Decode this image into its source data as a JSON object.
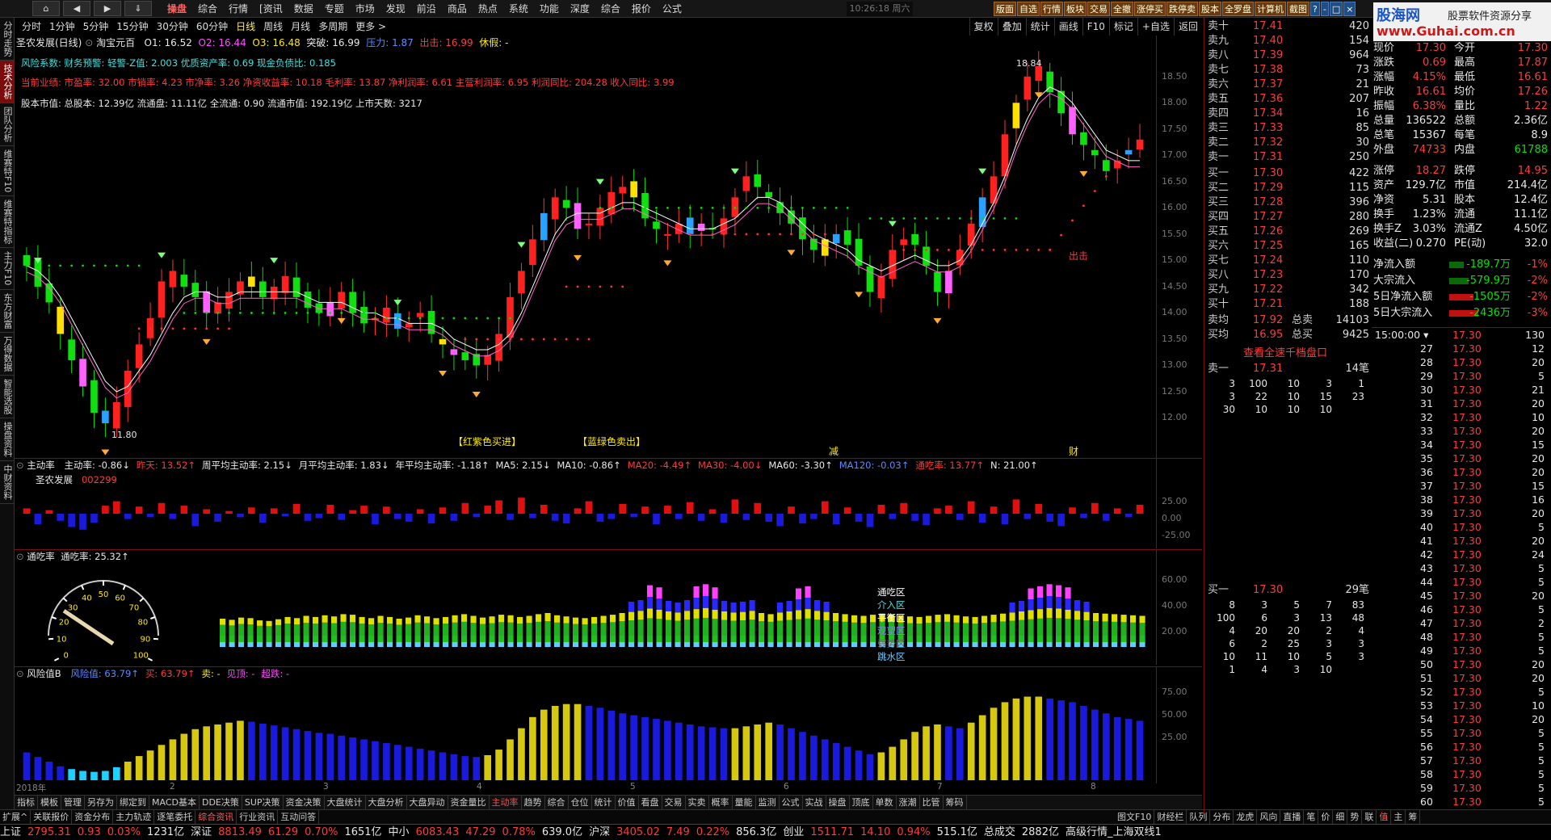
{
  "menubar": {
    "nav": [
      "⌂",
      "◀",
      "▶",
      "⇓"
    ],
    "menus": [
      "操盘",
      "综合",
      "行情",
      "[资讯",
      "数据",
      "专题",
      "市场",
      "发现",
      "前沿",
      "商品",
      "热点",
      "系统",
      "功能",
      "深度",
      "综合",
      "报价",
      "公式"
    ],
    "active_menu": "操盘",
    "clock": "10:26:18 周六",
    "tools": [
      "版面",
      "自选",
      "行情",
      "板块",
      "交易",
      "全撤",
      "涨停买",
      "跌停卖",
      "股本",
      "全罗盘",
      "计算机",
      "截图",
      "?",
      "-",
      "□",
      "×"
    ]
  },
  "logo": {
    "line1": "股海网",
    "line2": "股票软件资源分享",
    "line3": "www.Guhai.com.cn"
  },
  "left_tabs": [
    "分时走势",
    "技术分析",
    "团队分析",
    "维赛特F10",
    "维赛特指标",
    "主力F10",
    "东方财富",
    "万得数据",
    "智能选股",
    "操盘资料",
    "中财资料"
  ],
  "periods": [
    "分时",
    "1分钟",
    "5分钟",
    "15分钟",
    "30分钟",
    "60分钟",
    "日线",
    "周线",
    "月线",
    "多周期",
    "更多 >"
  ],
  "active_period": "日线",
  "right_tools": [
    "复权",
    "叠加",
    "统计",
    "画线",
    "F10",
    "标记",
    "+自选",
    "返回"
  ],
  "stock": {
    "name": "圣农发展(日线)",
    "sub": "淘宝元百",
    "o1": "O1: 16.52",
    "o2": "O2: 16.44",
    "o3": "O3: 16.48",
    "tupo": "突破: 16.99",
    "yali": "压力: 1.87",
    "chuhuo": "出击: 16.99",
    "xiu": "休假: -"
  },
  "info": [
    "风险系数: 财务预警: 轻警-Z值: 2.003 优质资产率: 0.69 现金负债比: 0.185",
    "当前业绩: 市盈率: 32.00 市销率: 4.23 市净率: 3.26 净资收益率: 10.18 毛利率: 13.87 净利润率: 6.61 主营利润率: 6.95 利润同比: 204.28 收入同比: 3.99",
    "股本市值: 总股本: 12.39亿 流通盘: 11.11亿 全流通: 0.90 流通市值: 192.19亿 上市天数: 3217"
  ],
  "signals": {
    "buy": "【红紫色买进】",
    "sell": "【蓝绿色卖出】",
    "jian": "减",
    "cai": "财",
    "chu": "出击",
    "high": "18.84",
    "low": "11.80"
  },
  "price_axis": [
    "18.50",
    "18.00",
    "17.50",
    "17.00",
    "16.50",
    "16.00",
    "15.50",
    "15.00",
    "14.50",
    "14.00",
    "13.50",
    "13.00",
    "12.50",
    "12.00"
  ],
  "price_axis_values": [
    18.5,
    18.0,
    17.5,
    17.0,
    16.5,
    16.0,
    15.5,
    15.0,
    14.5,
    14.0,
    13.5,
    13.0,
    12.5,
    12.0
  ],
  "chart_data": {
    "type": "candlestick",
    "closes": [
      14.9,
      14.5,
      14.2,
      13.6,
      13.1,
      12.6,
      12.1,
      11.9,
      12.3,
      12.9,
      13.4,
      13.9,
      14.6,
      14.8,
      14.5,
      14.3,
      14.0,
      14.2,
      14.4,
      14.6,
      14.5,
      14.3,
      14.5,
      14.7,
      14.3,
      14.1,
      14.0,
      14.2,
      14.4,
      14.0,
      13.8,
      13.9,
      14.1,
      13.7,
      13.8,
      14.0,
      13.6,
      13.4,
      13.2,
      13.1,
      13.0,
      13.2,
      13.6,
      14.3,
      14.8,
      15.4,
      15.9,
      16.2,
      16.0,
      15.6,
      15.7,
      16.0,
      16.3,
      16.4,
      16.2,
      15.8,
      15.6,
      15.5,
      15.7,
      15.5,
      15.7,
      15.6,
      15.8,
      16.2,
      16.6,
      16.4,
      16.2,
      15.9,
      15.7,
      15.4,
      15.2,
      15.4,
      15.5,
      15.3,
      14.9,
      14.4,
      14.7,
      15.2,
      15.4,
      15.3,
      14.9,
      14.4,
      14.8,
      15.2,
      15.7,
      16.2,
      16.6,
      17.4,
      18.0,
      18.5,
      18.7,
      18.2,
      17.8,
      17.4,
      17.2,
      17.0,
      16.7,
      16.9,
      17.1,
      17.3
    ],
    "ma": [
      14.9,
      14.8,
      14.6,
      14.3,
      13.9,
      13.5,
      13.1,
      12.7,
      12.5,
      12.6,
      12.9,
      13.2,
      13.6,
      14.0,
      14.3,
      14.4,
      14.4,
      14.3,
      14.3,
      14.4,
      14.4,
      14.4,
      14.4,
      14.4,
      14.4,
      14.3,
      14.2,
      14.2,
      14.2,
      14.1,
      14.0,
      14.0,
      13.9,
      13.9,
      13.8,
      13.8,
      13.8,
      13.7,
      13.5,
      13.4,
      13.3,
      13.3,
      13.4,
      13.6,
      14.0,
      14.5,
      15.0,
      15.5,
      15.8,
      15.9,
      15.9,
      15.9,
      16.0,
      16.1,
      16.1,
      16.0,
      15.9,
      15.8,
      15.7,
      15.6,
      15.6,
      15.6,
      15.7,
      15.8,
      16.0,
      16.2,
      16.2,
      16.1,
      15.9,
      15.7,
      15.5,
      15.4,
      15.3,
      15.2,
      15.0,
      14.9,
      14.8,
      14.9,
      15.0,
      15.1,
      15.0,
      14.9,
      14.9,
      15.0,
      15.3,
      15.7,
      16.1,
      16.6,
      17.2,
      17.7,
      18.1,
      18.3,
      18.2,
      18.0,
      17.7,
      17.4,
      17.1,
      17.0,
      16.9,
      16.9
    ],
    "zhudong": [
      6,
      -12,
      4,
      -8,
      -15,
      -18,
      -10,
      9,
      14,
      -6,
      8,
      -4,
      12,
      -6,
      9,
      -14,
      5,
      -9,
      3,
      -4,
      7,
      -10,
      6,
      -3,
      11,
      -8,
      -5,
      10,
      -7,
      4,
      9,
      -12,
      8,
      -6,
      -9,
      5,
      -11,
      7,
      -8,
      12,
      -4,
      9,
      15,
      -7,
      18,
      -5,
      10,
      -8,
      -11,
      6,
      14,
      -9,
      -6,
      11,
      -4,
      8,
      -12,
      9,
      -6,
      13,
      -8,
      5,
      -10,
      16,
      -7,
      12,
      -9,
      -14,
      8,
      -11,
      -6,
      14,
      -12,
      7,
      -9,
      -15,
      10,
      -6,
      12,
      -8,
      -13,
      6,
      9,
      -7,
      14,
      -10,
      8,
      -12,
      16,
      -6,
      11,
      -9,
      -14,
      7,
      -5,
      12,
      -8,
      6,
      -4,
      10
    ],
    "tongchi": [
      30,
      28,
      32,
      31,
      27,
      26,
      29,
      33,
      31,
      35,
      33,
      36,
      34,
      38,
      37,
      33,
      31,
      35,
      33,
      30,
      32,
      36,
      34,
      31,
      33,
      36,
      38,
      35,
      32,
      34,
      37,
      36,
      33,
      35,
      38,
      40,
      36,
      34,
      32,
      31,
      33,
      35,
      37,
      40,
      42,
      44,
      48,
      46,
      43,
      41,
      44,
      47,
      49,
      46,
      43,
      41,
      42,
      44,
      40,
      38,
      41,
      43,
      45,
      47,
      44,
      42,
      40,
      38,
      36,
      35,
      37,
      39,
      38,
      36,
      34,
      33,
      35,
      37,
      38,
      36,
      34,
      33,
      35,
      37,
      39,
      41,
      43,
      45,
      47,
      49,
      48,
      46,
      44,
      42,
      40,
      39,
      38,
      37,
      36,
      35
    ],
    "fengxian": [
      30,
      25,
      20,
      15,
      12,
      10,
      9,
      10,
      14,
      20,
      26,
      32,
      38,
      44,
      50,
      55,
      58,
      60,
      62,
      64,
      63,
      61,
      59,
      57,
      55,
      53,
      51,
      50,
      48,
      46,
      44,
      42,
      40,
      38,
      36,
      34,
      32,
      30,
      28,
      26,
      25,
      27,
      33,
      44,
      56,
      68,
      76,
      80,
      82,
      82,
      80,
      78,
      75,
      72,
      70,
      68,
      66,
      64,
      62,
      60,
      58,
      57,
      56,
      56,
      58,
      60,
      62,
      60,
      56,
      52,
      48,
      44,
      40,
      36,
      32,
      28,
      30,
      36,
      44,
      52,
      58,
      60,
      58,
      56,
      62,
      70,
      78,
      84,
      88,
      90,
      90,
      88,
      86,
      84,
      80,
      76,
      72,
      68,
      66,
      64
    ]
  },
  "subp1": {
    "title": "主动率",
    "items": [
      "主动率: -0.86↓",
      "昨天: 13.52↑",
      "周平均主动率: 2.15↓",
      "月平均主动率: 1.83↓",
      "年平均主动率: -1.18↑",
      "MA5: 2.15↓",
      "MA10: -0.86↑",
      "MA20: -4.49↑",
      "MA30: -4.00↓",
      "MA60: -3.30↑",
      "MA120: -0.03↑",
      "通吃率: 13.77↑",
      "N: 21.00↑"
    ],
    "stock": "圣农发展",
    "code": "002299",
    "axis": [
      "25.00",
      "0.00",
      "-25.00"
    ]
  },
  "subp2": {
    "title": "通吃率",
    "value": "通吃率: 25.32↑",
    "axis": [
      "60.00",
      "40.00",
      "20.00"
    ],
    "legend": [
      "通吃区",
      "介入区",
      "平衡区",
      "观望区",
      "弱势区",
      "跳水区"
    ],
    "gauge_labels": [
      "0",
      "10",
      "20",
      "30",
      "40",
      "50",
      "60",
      "70",
      "80",
      "90",
      "100"
    ]
  },
  "subp3": {
    "title": "风险值B",
    "items": [
      "风险值: 63.79↑",
      "买: 63.79↑",
      "卖: -",
      "见顶: -",
      "超跌: -"
    ],
    "axis": [
      "75.00",
      "50.00",
      "25.00"
    ],
    "dates": [
      "2018年",
      "2",
      "3",
      "4",
      "5",
      "6",
      "7",
      "8"
    ]
  },
  "bottom_tabs": [
    "指标",
    "模板",
    "管理",
    "另存为",
    "绑定到",
    "MACD基本",
    "DDE决策",
    "SUP决策",
    "资金决策",
    "大盘统计",
    "大盘分析",
    "大盘异动",
    "资金量比",
    "主动率",
    "趋势",
    "综合",
    "仓位",
    "统计",
    "价值",
    "看盘",
    "交易",
    "实卖",
    "概率",
    "量能",
    "监测",
    "公式",
    "实战",
    "操盘",
    "顶底",
    "单数",
    "涨潮",
    "比管",
    "筹码"
  ],
  "active_bottom_tab": "主动率",
  "extra_tabs": [
    "扩展^",
    "关联报价",
    "资金分布",
    "主力轨迹",
    "逐笔委托",
    "综合资讯",
    "行业资讯",
    "互动问答"
  ],
  "extra_right": [
    "图文F10",
    "财经栏",
    "队列",
    "分布",
    "龙虎",
    "风向",
    "直播",
    "笔",
    "价",
    "细",
    "势",
    "联",
    "值",
    "主",
    "筹"
  ],
  "orderbook": {
    "sell": [
      [
        "卖十",
        "17.41",
        "420"
      ],
      [
        "卖九",
        "17.40",
        "154"
      ],
      [
        "卖八",
        "17.39",
        "964"
      ],
      [
        "卖七",
        "17.38",
        "73"
      ],
      [
        "卖六",
        "17.37",
        "21"
      ],
      [
        "卖五",
        "17.36",
        "207"
      ],
      [
        "卖四",
        "17.34",
        "16"
      ],
      [
        "卖三",
        "17.33",
        "85"
      ],
      [
        "卖二",
        "17.32",
        "30"
      ],
      [
        "卖一",
        "17.31",
        "250"
      ]
    ],
    "buy": [
      [
        "买一",
        "17.30",
        "422"
      ],
      [
        "买二",
        "17.29",
        "115"
      ],
      [
        "买三",
        "17.28",
        "396"
      ],
      [
        "买四",
        "17.27",
        "280"
      ],
      [
        "买五",
        "17.26",
        "269"
      ],
      [
        "买六",
        "17.25",
        "165"
      ],
      [
        "买七",
        "17.24",
        "110"
      ],
      [
        "买八",
        "17.23",
        "170"
      ],
      [
        "买九",
        "17.22",
        "342"
      ],
      [
        "买十",
        "17.21",
        "188"
      ]
    ],
    "avg": [
      [
        "卖均",
        "17.92",
        "总卖",
        "14103"
      ],
      [
        "买均",
        "16.95",
        "总买",
        "9425"
      ]
    ],
    "link": "查看全速千档盘口",
    "q1": {
      "label": "卖一",
      "price": "17.31",
      "count": "14笔",
      "rows": [
        [
          "3",
          "100",
          "10",
          "3",
          "1"
        ],
        [
          "3",
          "22",
          "10",
          "15",
          "23"
        ],
        [
          "30",
          "10",
          "10",
          "10",
          ""
        ]
      ]
    },
    "q2": {
      "label": "买一",
      "price": "17.30",
      "count": "29笔",
      "rows": [
        [
          "8",
          "3",
          "5",
          "7",
          "83"
        ],
        [
          "100",
          "6",
          "3",
          "13",
          "48"
        ],
        [
          "4",
          "20",
          "20",
          "2",
          "4"
        ],
        [
          "6",
          "2",
          "25",
          "3",
          "3"
        ],
        [
          "10",
          "11",
          "10",
          "5",
          "3"
        ],
        [
          "1",
          "4",
          "3",
          "10",
          ""
        ]
      ]
    }
  },
  "stats": [
    [
      "现价",
      "17.30",
      "今开",
      "17.30"
    ],
    [
      "涨跌",
      "0.69",
      "最高",
      "17.87"
    ],
    [
      "涨幅",
      "4.15%",
      "最低",
      "16.61"
    ],
    [
      "昨收",
      "16.61",
      "均价",
      "17.26"
    ],
    [
      "振幅",
      "6.38%",
      "量比",
      "1.22"
    ],
    [
      "总量",
      "136522",
      "总额",
      "2.36亿"
    ],
    [
      "总笔",
      "15367",
      "每笔",
      "8.9"
    ],
    [
      "外盘",
      "74733",
      "内盘",
      "61788"
    ],
    [
      "涨停",
      "18.27",
      "跌停",
      "14.95"
    ],
    [
      "资产",
      "129.7亿",
      "市值",
      "214.4亿"
    ],
    [
      "净资",
      "5.31",
      "股本",
      "12.4亿"
    ],
    [
      "换手",
      "1.23%",
      "流通",
      "11.1亿"
    ],
    [
      "换手Z",
      "3.03%",
      "流通Z",
      "4.50亿"
    ],
    [
      "收益(二)",
      "0.270",
      "PE(动)",
      "32.0"
    ]
  ],
  "flows": [
    [
      "净流入额",
      "-189.7万",
      "-1%"
    ],
    [
      "大宗流入",
      "-579.9万",
      "-2%"
    ],
    [
      "5日净流入额",
      "-1505万",
      "-2%"
    ],
    [
      "5日大宗流入",
      "-2436万",
      "-3%"
    ]
  ],
  "ticks": {
    "header": [
      "15:00:00 ▾",
      "17.30",
      "130"
    ],
    "rows": [
      [
        "27",
        "17.30",
        "12"
      ],
      [
        "28",
        "17.30",
        "20"
      ],
      [
        "29",
        "17.30",
        "5"
      ],
      [
        "30",
        "17.30",
        "21"
      ],
      [
        "31",
        "17.30",
        "20"
      ],
      [
        "32",
        "17.30",
        "10"
      ],
      [
        "33",
        "17.30",
        "20"
      ],
      [
        "34",
        "17.30",
        "15"
      ],
      [
        "35",
        "17.30",
        "20"
      ],
      [
        "36",
        "17.30",
        "20"
      ],
      [
        "37",
        "17.30",
        "15"
      ],
      [
        "38",
        "17.30",
        "16"
      ],
      [
        "39",
        "17.30",
        "20"
      ],
      [
        "40",
        "17.30",
        "5"
      ],
      [
        "41",
        "17.30",
        "20"
      ],
      [
        "42",
        "17.30",
        "24"
      ],
      [
        "43",
        "17.30",
        "5"
      ],
      [
        "44",
        "17.30",
        "5"
      ],
      [
        "45",
        "17.30",
        "20"
      ],
      [
        "46",
        "17.30",
        "5"
      ],
      [
        "47",
        "17.30",
        "2"
      ],
      [
        "48",
        "17.30",
        "5"
      ],
      [
        "49",
        "17.30",
        "5"
      ],
      [
        "50",
        "17.30",
        "20"
      ],
      [
        "51",
        "17.30",
        "20"
      ],
      [
        "52",
        "17.30",
        "5"
      ],
      [
        "53",
        "17.30",
        "10"
      ],
      [
        "54",
        "17.30",
        "20"
      ],
      [
        "55",
        "17.30",
        "5"
      ],
      [
        "56",
        "17.30",
        "5"
      ],
      [
        "57",
        "17.30",
        "5"
      ],
      [
        "58",
        "17.30",
        "5"
      ],
      [
        "59",
        "17.30",
        "5"
      ],
      [
        "60",
        "17.30",
        "5"
      ]
    ]
  },
  "status": {
    "items": [
      [
        "上证",
        "2795.31",
        "0.93",
        "0.03%",
        "1231亿"
      ],
      [
        "深证",
        "8813.49",
        "61.29",
        "0.70%",
        "1651亿"
      ],
      [
        "中小",
        "6083.43",
        "47.29",
        "0.78%",
        "639.0亿"
      ],
      [
        "沪深",
        "3405.02",
        "7.49",
        "0.22%",
        "856.3亿"
      ],
      [
        "创业",
        "1511.71",
        "14.10",
        "0.94%",
        "515.1亿"
      ]
    ],
    "total": "总成交",
    "total_val": "2882亿",
    "feed": "高级行情_上海双线1"
  },
  "colors": {
    "up": "#ff3333",
    "down": "#00dd00",
    "grid_border": "#7a1010",
    "blue_bar": "#1a1adc",
    "yellow_bar": "#d6c810"
  }
}
